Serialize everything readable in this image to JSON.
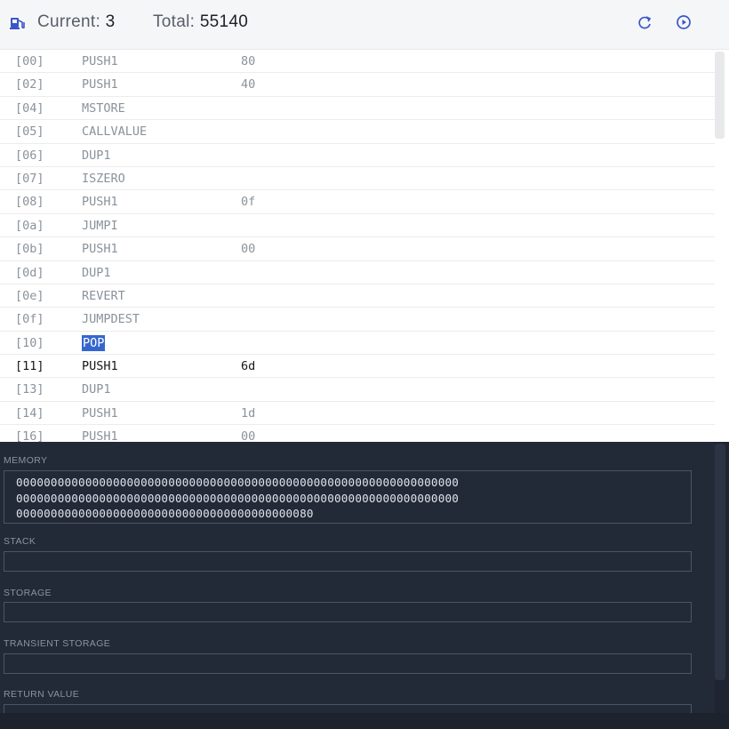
{
  "header": {
    "current_label": "Current:",
    "current_value": "3",
    "total_label": "Total:",
    "total_value": "55140"
  },
  "opcodes": [
    {
      "pc": "[00]",
      "op": "PUSH1",
      "arg": "80"
    },
    {
      "pc": "[02]",
      "op": "PUSH1",
      "arg": "40"
    },
    {
      "pc": "[04]",
      "op": "MSTORE",
      "arg": ""
    },
    {
      "pc": "[05]",
      "op": "CALLVALUE",
      "arg": ""
    },
    {
      "pc": "[06]",
      "op": "DUP1",
      "arg": ""
    },
    {
      "pc": "[07]",
      "op": "ISZERO",
      "arg": ""
    },
    {
      "pc": "[08]",
      "op": "PUSH1",
      "arg": "0f"
    },
    {
      "pc": "[0a]",
      "op": "JUMPI",
      "arg": ""
    },
    {
      "pc": "[0b]",
      "op": "PUSH1",
      "arg": "00"
    },
    {
      "pc": "[0d]",
      "op": "DUP1",
      "arg": ""
    },
    {
      "pc": "[0e]",
      "op": "REVERT",
      "arg": ""
    },
    {
      "pc": "[0f]",
      "op": "JUMPDEST",
      "arg": ""
    },
    {
      "pc": "[10]",
      "op": "POP",
      "arg": ""
    },
    {
      "pc": "[11]",
      "op": "PUSH1",
      "arg": "6d"
    },
    {
      "pc": "[13]",
      "op": "DUP1",
      "arg": ""
    },
    {
      "pc": "[14]",
      "op": "PUSH1",
      "arg": "1d"
    },
    {
      "pc": "[16]",
      "op": "PUSH1",
      "arg": "00"
    }
  ],
  "selected_row": 12,
  "current_row": 13,
  "panel": {
    "memory_label": "MEMORY",
    "memory_lines": [
      "0000000000000000000000000000000000000000000000000000000000000000",
      "0000000000000000000000000000000000000000000000000000000000000000",
      "0000000000000000000000000000000000000000080"
    ],
    "stack_label": "STACK",
    "stack_value": "",
    "storage_label": "STORAGE",
    "storage_value": "",
    "transient_label": "TRANSIENT STORAGE",
    "transient_value": "",
    "return_label": "RETURN VALUE",
    "return_value": ""
  },
  "colors": {
    "accent": "#3566cf",
    "panel_bg": "#222a37"
  },
  "icons": {
    "gas": "gas-pump-icon",
    "replay": "replay-icon",
    "play": "play-circle-icon"
  }
}
